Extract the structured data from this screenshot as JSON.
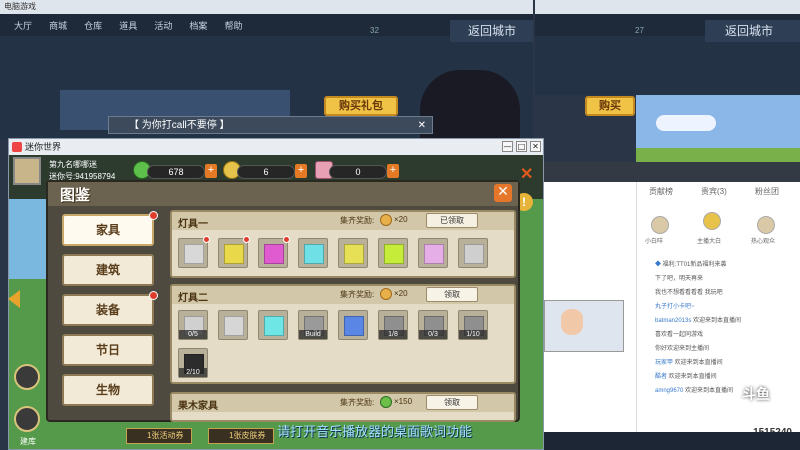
{
  "bg_left": {
    "title": "电脑游戏",
    "nav": [
      "大厅",
      "商城",
      "仓库",
      "道具",
      "活动",
      "档案",
      "帮助"
    ],
    "return_label": "返回城市",
    "buy_label": "购买礼包",
    "page_counter": "32"
  },
  "bg_right": {
    "nav": [
      "返回城市"
    ],
    "return_label": "返回城市",
    "buy_label": "购买",
    "page_counter": "27"
  },
  "call_window": {
    "text": "【 为你打call不要停 】",
    "close": "✕"
  },
  "game_window": {
    "title": "迷你世界",
    "controls": [
      "—",
      "□",
      "✕"
    ]
  },
  "player": {
    "name": "第九名哪哪迷",
    "id_label": "迷你号:941958794"
  },
  "resources": [
    {
      "value": "678"
    },
    {
      "value": "6"
    },
    {
      "value": "0"
    }
  ],
  "panel": {
    "title": "图鉴",
    "close": "✕"
  },
  "categories": [
    {
      "label": "家具",
      "selected": true,
      "dot": true
    },
    {
      "label": "建筑",
      "selected": false,
      "dot": false
    },
    {
      "label": "装备",
      "selected": false,
      "dot": true
    },
    {
      "label": "节日",
      "selected": false,
      "dot": false
    },
    {
      "label": "生物",
      "selected": false,
      "dot": false
    }
  ],
  "sections": [
    {
      "name": "灯具一",
      "reward_label": "集齐奖励:",
      "reward_value": "×20",
      "button": "已领取",
      "items": [
        {
          "color": "#d8d8d8",
          "dot": true
        },
        {
          "color": "#e9d84a",
          "dot": true
        },
        {
          "color": "#e05ad0",
          "dot": true
        },
        {
          "color": "#6fe0e6",
          "dot": false
        },
        {
          "color": "#e6e056",
          "dot": false
        },
        {
          "color": "#c6ec3a",
          "dot": false
        },
        {
          "color": "#e6aee6",
          "dot": false
        },
        {
          "color": "#cfcfcf",
          "dot": false
        }
      ]
    },
    {
      "name": "灯具二",
      "reward_label": "集齐奖励:",
      "reward_value": "×20",
      "button": "领取",
      "items": [
        {
          "color": "#d0d0d0",
          "count": "0/5"
        },
        {
          "color": "#d6d6d6",
          "count": ""
        },
        {
          "color": "#6fe6e6",
          "count": ""
        },
        {
          "color": "#9a9a9a",
          "count": "Build"
        },
        {
          "color": "#5a86e6",
          "count": ""
        },
        {
          "color": "#8f8f8f",
          "count": "1/8"
        },
        {
          "color": "#8f8f8f",
          "count": "0/3"
        },
        {
          "color": "#8f8f8f",
          "count": "1/10"
        },
        {
          "color": "#2c2c2c",
          "count": "2/10"
        }
      ]
    },
    {
      "name": "果木家具",
      "reward_label": "集齐奖励:",
      "reward_value": "×150",
      "button": "领取",
      "items": []
    }
  ],
  "bottom_buttons": [
    "1张活动券",
    "1张皮肤券"
  ],
  "side_label": "建库",
  "subtitle": "请打开音乐播放器的桌面歌词功能",
  "stream": {
    "tabs": [
      "贡献榜",
      "贵宾(3)",
      "粉丝团"
    ],
    "rank_labels": [
      "小白咩",
      "主播大白",
      "热心观众"
    ],
    "chat": [
      {
        "name": "◆",
        "msg": "福利:TT01新品福利来袭"
      },
      {
        "name": "",
        "msg": "下了吧，明天再来"
      },
      {
        "name": "",
        "msg": "我也不想看看看看 我玩吧"
      },
      {
        "name": "丸子打小卡吧~",
        "msg": ""
      },
      {
        "name": "batman2013s",
        "msg": "欢迎来到本直播间"
      },
      {
        "name": "",
        "msg": "喜欢看一起同游戏"
      },
      {
        "name": "",
        "msg": "你好欢迎来到主播间"
      },
      {
        "name": "玩家甲",
        "msg": "欢迎来到本直播间"
      },
      {
        "name": "酷者",
        "msg": "欢迎来到本直播间"
      },
      {
        "name": "amng9670",
        "msg": "欢迎来到本直播间"
      }
    ],
    "viewer_count": "1515240",
    "logo": "斗鱼"
  }
}
